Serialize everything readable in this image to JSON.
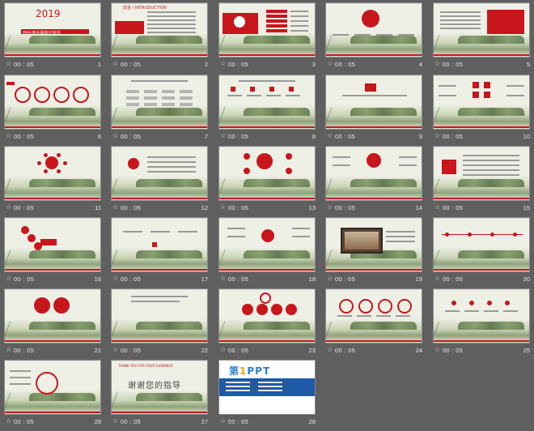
{
  "slides": [
    {
      "num": "1",
      "time": "00 : 05",
      "title": "2019",
      "subtitle": "创业/商业融资计划书"
    },
    {
      "num": "2",
      "time": "00 : 05",
      "label": "前言 / INTRODUCTION"
    },
    {
      "num": "3",
      "time": "00 : 05"
    },
    {
      "num": "4",
      "time": "00 : 05"
    },
    {
      "num": "5",
      "time": "00 : 05"
    },
    {
      "num": "6",
      "time": "00 : 05"
    },
    {
      "num": "7",
      "time": "00 : 05"
    },
    {
      "num": "8",
      "time": "00 : 05"
    },
    {
      "num": "9",
      "time": "00 : 05"
    },
    {
      "num": "10",
      "time": "00 : 05"
    },
    {
      "num": "11",
      "time": "00 : 05"
    },
    {
      "num": "12",
      "time": "00 : 05"
    },
    {
      "num": "13",
      "time": "00 : 05"
    },
    {
      "num": "14",
      "time": "00 : 05"
    },
    {
      "num": "15",
      "time": "00 : 05"
    },
    {
      "num": "16",
      "time": "00 : 05"
    },
    {
      "num": "17",
      "time": "00 : 05"
    },
    {
      "num": "18",
      "time": "00 : 05"
    },
    {
      "num": "19",
      "time": "00 : 05"
    },
    {
      "num": "20",
      "time": "00 : 05"
    },
    {
      "num": "21",
      "time": "00 : 05"
    },
    {
      "num": "22",
      "time": "00 : 05"
    },
    {
      "num": "23",
      "time": "00 : 05"
    },
    {
      "num": "24",
      "time": "00 : 05"
    },
    {
      "num": "25",
      "time": "00 : 05"
    },
    {
      "num": "26",
      "time": "00 : 05"
    },
    {
      "num": "27",
      "time": "00 : 05",
      "title": "谢谢您的指导",
      "en": "THANK YOU FOR YOUR GUIDANCE"
    },
    {
      "num": "28",
      "time": "00 : 05",
      "logo_a": "第",
      "logo_b": "1",
      "logo_c": "PPT"
    }
  ],
  "colors": {
    "accent": "#c8161d",
    "background": "#5f5f5f",
    "slide_bg": "#eef0e6"
  }
}
